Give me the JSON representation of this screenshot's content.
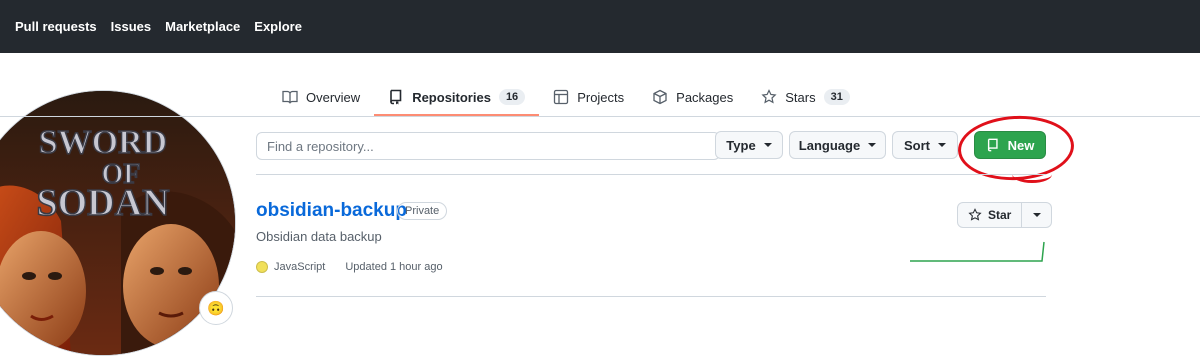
{
  "header": {
    "nav": [
      "Pull requests",
      "Issues",
      "Marketplace",
      "Explore"
    ]
  },
  "profile": {
    "avatar_text_line1": "SWORD",
    "avatar_text_line2": "OF",
    "avatar_text_line3": "SODAN",
    "status_emoji": "🙃"
  },
  "tabs": [
    {
      "label": "Overview",
      "icon": "book-icon"
    },
    {
      "label": "Repositories",
      "icon": "repo-icon",
      "count": "16",
      "selected": true
    },
    {
      "label": "Projects",
      "icon": "table-icon"
    },
    {
      "label": "Packages",
      "icon": "package-icon"
    },
    {
      "label": "Stars",
      "icon": "star-icon",
      "count": "31"
    }
  ],
  "filters": {
    "search_placeholder": "Find a repository...",
    "type_label": "Type",
    "language_label": "Language",
    "sort_label": "Sort",
    "new_label": "New"
  },
  "repo": {
    "name": "obsidian-backup",
    "visibility": "Private",
    "description": "Obsidian data backup",
    "language": "JavaScript",
    "updated": "Updated 1 hour ago",
    "star_label": "Star"
  },
  "colors": {
    "accent_green": "#2da44e",
    "link_blue": "#0969da",
    "selected_tab_underline": "#fd8c73",
    "annotation_red": "#e0101a",
    "javascript_dot": "#f1e05a"
  }
}
